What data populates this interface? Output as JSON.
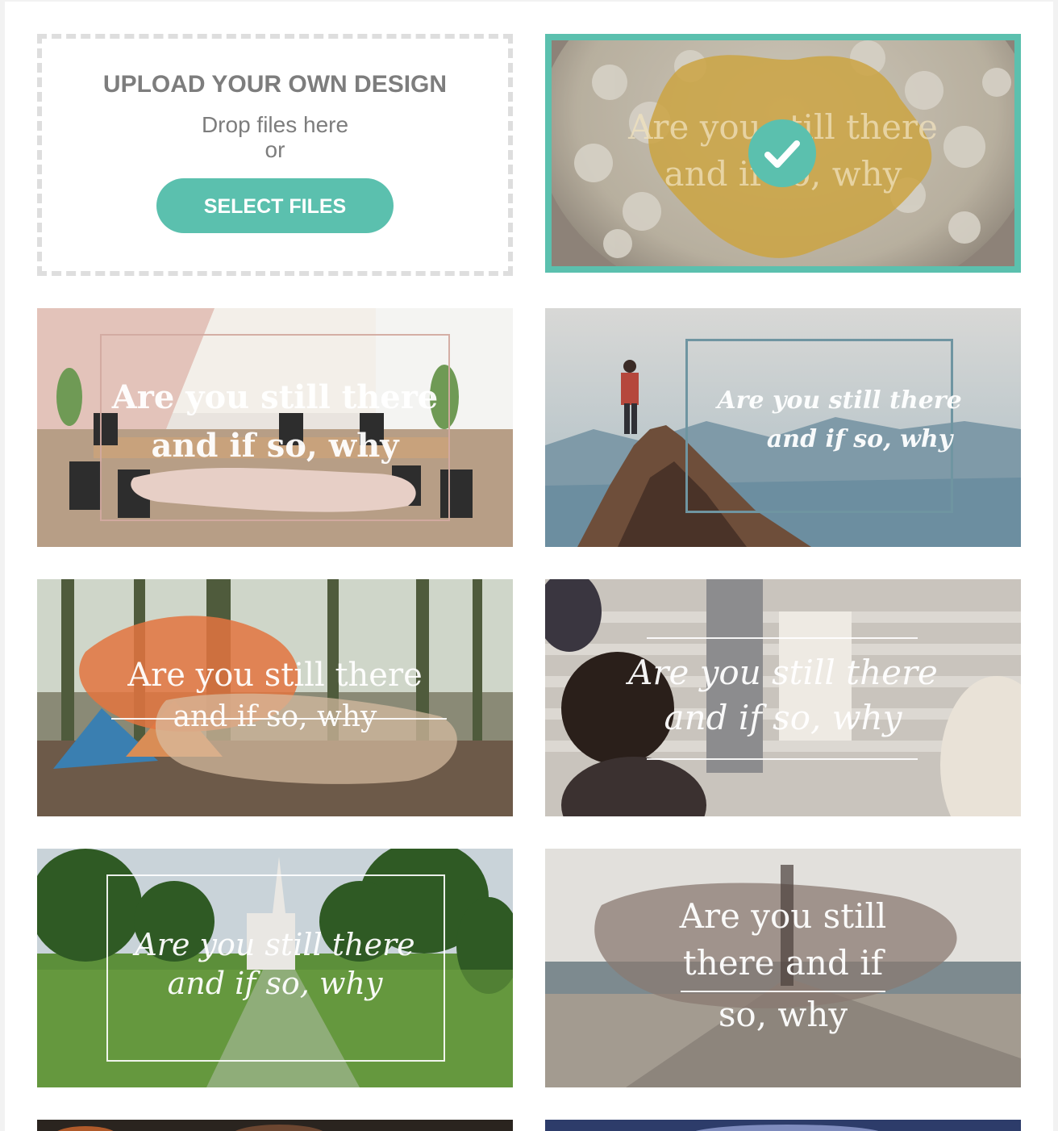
{
  "upload": {
    "title": "UPLOAD YOUR OWN DESIGN",
    "drop_text": "Drop files here",
    "or_text": "or",
    "button_label": "SELECT FILES"
  },
  "accent_color": "#5bc0ae",
  "designs": [
    {
      "line1": "Are you still there",
      "line2": "and if so, why",
      "selected": true
    },
    {
      "line1": "Are you still there",
      "line2": "and if so, why",
      "selected": false
    },
    {
      "line1": "Are you still there",
      "line2": "and if so, why",
      "selected": false
    },
    {
      "line1": "Are you still there",
      "line2": "and if so, why",
      "selected": false
    },
    {
      "line1": "Are you still there",
      "line2": "and if so, why",
      "selected": false
    },
    {
      "line1": "Are you still there",
      "line2": "and if so, why",
      "selected": false
    },
    {
      "line1": "Are you still",
      "line2": "there and if",
      "line3": "so, why",
      "selected": false
    }
  ]
}
